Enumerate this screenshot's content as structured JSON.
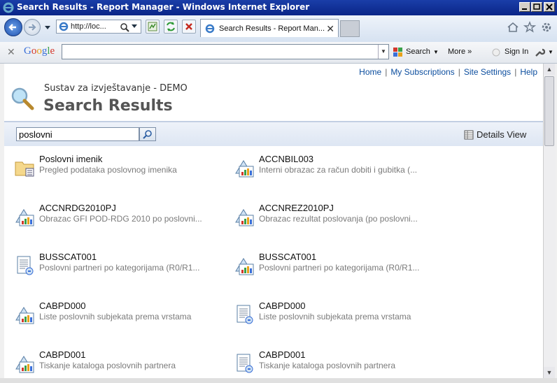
{
  "window": {
    "title": "Search Results - Report Manager - Windows Internet Explorer"
  },
  "nav": {
    "address": "http://loc...",
    "tab_label": "Search Results - Report Man..."
  },
  "gbar": {
    "brand": "Google",
    "search_value": "",
    "search_label": "Search",
    "more_label": "More »",
    "signin_label": "Sign In"
  },
  "page": {
    "links": [
      "Home",
      "My Subscriptions",
      "Site Settings",
      "Help"
    ],
    "site_title": "Sustav za izvještavanje - DEMO",
    "title": "Search Results",
    "search_value": "poslovni",
    "view_label": "Details View"
  },
  "results": [
    {
      "name": "Poslovni imenik",
      "desc": "Pregled podataka poslovnog imenika",
      "icon": "folder-icon"
    },
    {
      "name": "ACCNBIL003",
      "desc": "Interni obrazac za račun dobiti i gubitka (...",
      "icon": "report-chart-icon"
    },
    {
      "name": "ACCNRDG2010PJ",
      "desc": "Obrazac GFI POD-RDG 2010 po poslovni...",
      "icon": "report-chart-icon"
    },
    {
      "name": "ACCNREZ2010PJ",
      "desc": "Obrazac rezultat poslovanja (po poslovni...",
      "icon": "report-chart-icon"
    },
    {
      "name": "BUSSCAT001",
      "desc": "Poslovni partneri po kategorijama (R0/R1...",
      "icon": "report-document-icon"
    },
    {
      "name": "BUSSCAT001",
      "desc": "Poslovni partneri po kategorijama (R0/R1...",
      "icon": "report-chart-icon"
    },
    {
      "name": "CABPD000",
      "desc": "Liste poslovnih subjekata prema vrstama",
      "icon": "report-chart-icon"
    },
    {
      "name": "CABPD000",
      "desc": "Liste poslovnih subjekata prema vrstama",
      "icon": "report-document-icon"
    },
    {
      "name": "CABPD001",
      "desc": "Tiskanje kataloga poslovnih partnera",
      "icon": "report-chart-icon"
    },
    {
      "name": "CABPD001",
      "desc": "Tiskanje kataloga poslovnih partnera",
      "icon": "report-document-icon"
    }
  ]
}
